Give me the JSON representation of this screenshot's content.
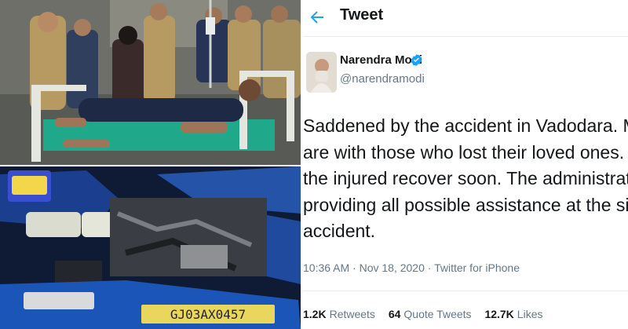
{
  "tweet": {
    "header_title": "Tweet",
    "author_name": "Narendra Modi",
    "author_handle": "@narendramodi",
    "text_lines": [
      "Saddened by the accident in Vadodara. My thought",
      "are with those who lost their loved ones. Praying th",
      "the injured recover soon. The administration is",
      "providing all possible assistance at the site of the",
      "accident."
    ],
    "timestamp": "10:36 AM · Nov 18, 2020 · Twitter for iPhone",
    "stats": [
      {
        "count": "1.2K",
        "label": "Retweets"
      },
      {
        "count": "64",
        "label": "Quote Tweets"
      },
      {
        "count": "12.7K",
        "label": "Likes"
      }
    ]
  },
  "photo_bottom": {
    "plate_text": "GJ03AX0457"
  },
  "colors": {
    "accent": "#1da1f2",
    "text_primary": "#14171a",
    "text_secondary": "#657786",
    "border": "#e6ecf0",
    "vehicle_blue": "#1b3e8f"
  },
  "icons": [
    "back-arrow-icon",
    "verified-badge-icon"
  ]
}
